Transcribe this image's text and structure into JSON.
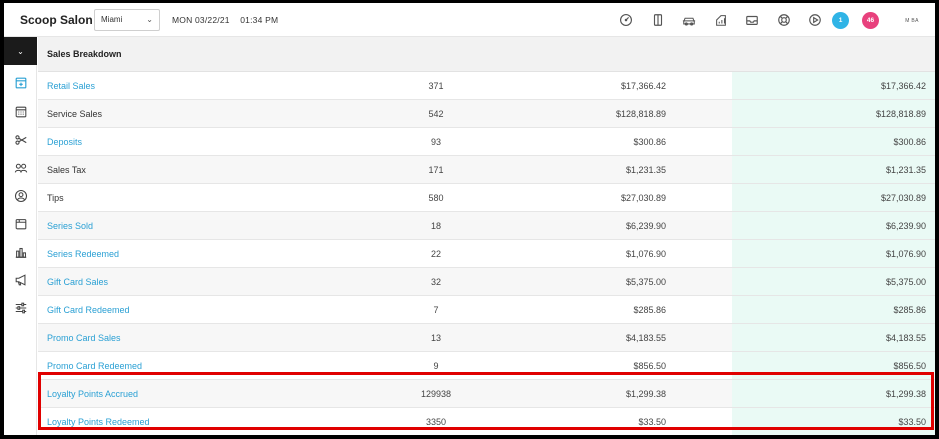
{
  "app": {
    "title": "Scoop Salon"
  },
  "location": {
    "selected": "Miami"
  },
  "datetime": {
    "date": "MON 03/22/21",
    "time": "01:34 PM"
  },
  "top_icons": [
    "speedometer-icon",
    "door-icon",
    "car-icon",
    "chart-clipboard-icon",
    "inbox-icon",
    "lifebuoy-icon",
    "play-circle-icon"
  ],
  "badges": {
    "blue": "1",
    "pink": "46"
  },
  "user": {
    "initials": "M BA"
  },
  "sidebar": {
    "icons": [
      "add-appointment-icon",
      "calendar-icon",
      "scissors-icon",
      "clients-icon",
      "user-circle-icon",
      "register-icon",
      "reports-icon",
      "megaphone-icon",
      "sliders-icon"
    ]
  },
  "section": {
    "title": "Sales Breakdown"
  },
  "rows": [
    {
      "name": "Retail Sales",
      "qty": "371",
      "amount": "$17,366.42",
      "total": "$17,366.42",
      "link": true
    },
    {
      "name": "Service Sales",
      "qty": "542",
      "amount": "$128,818.89",
      "total": "$128,818.89",
      "link": false
    },
    {
      "name": "Deposits",
      "qty": "93",
      "amount": "$300.86",
      "total": "$300.86",
      "link": true
    },
    {
      "name": "Sales Tax",
      "qty": "171",
      "amount": "$1,231.35",
      "total": "$1,231.35",
      "link": false
    },
    {
      "name": "Tips",
      "qty": "580",
      "amount": "$27,030.89",
      "total": "$27,030.89",
      "link": false
    },
    {
      "name": "Series Sold",
      "qty": "18",
      "amount": "$6,239.90",
      "total": "$6,239.90",
      "link": true
    },
    {
      "name": "Series Redeemed",
      "qty": "22",
      "amount": "$1,076.90",
      "total": "$1,076.90",
      "link": true
    },
    {
      "name": "Gift Card Sales",
      "qty": "32",
      "amount": "$5,375.00",
      "total": "$5,375.00",
      "link": true
    },
    {
      "name": "Gift Card Redeemed",
      "qty": "7",
      "amount": "$285.86",
      "total": "$285.86",
      "link": true
    },
    {
      "name": "Promo Card Sales",
      "qty": "13",
      "amount": "$4,183.55",
      "total": "$4,183.55",
      "link": true
    },
    {
      "name": "Promo Card Redeemed",
      "qty": "9",
      "amount": "$856.50",
      "total": "$856.50",
      "link": true
    },
    {
      "name": "Loyalty Points Accrued",
      "qty": "129938",
      "amount": "$1,299.38",
      "total": "$1,299.38",
      "link": true
    },
    {
      "name": "Loyalty Points Redeemed",
      "qty": "3350",
      "amount": "$33.50",
      "total": "$33.50",
      "link": true
    }
  ],
  "colors": {
    "link": "#2aa0d4",
    "highlight": "#e00000",
    "total_bg": "#eafaf5",
    "badge_blue": "#30b4e6",
    "badge_pink": "#e8417d"
  }
}
